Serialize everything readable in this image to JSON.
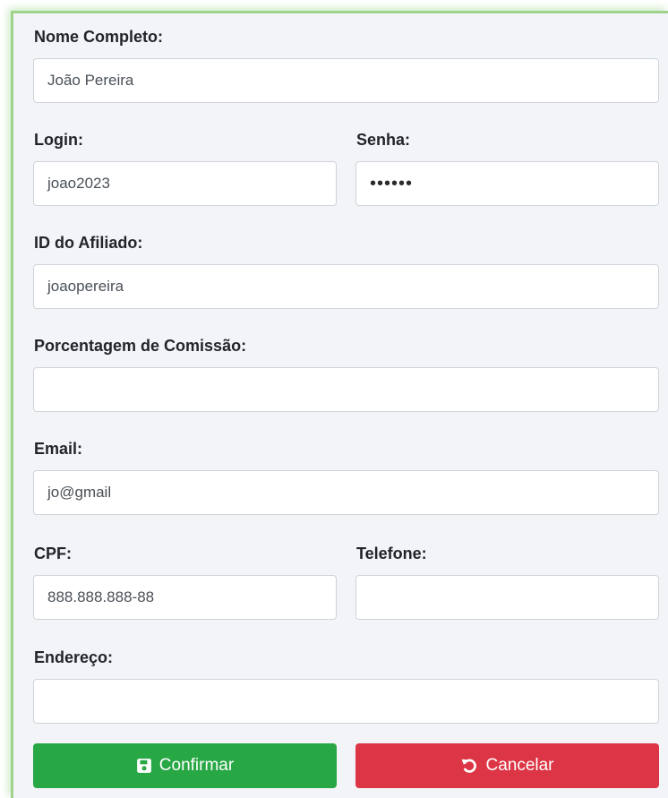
{
  "form": {
    "nome": {
      "label": "Nome Completo:",
      "value": "João Pereira"
    },
    "login": {
      "label": "Login:",
      "value": "joao2023"
    },
    "senha": {
      "label": "Senha:",
      "value": "••••••"
    },
    "afiliado": {
      "label": "ID do Afiliado:",
      "value": "joaopereira"
    },
    "comissao": {
      "label": "Porcentagem de Comissão:",
      "value": ""
    },
    "email": {
      "label": "Email:",
      "value": "jo@gmail"
    },
    "cpf": {
      "label": "CPF:",
      "value": "888.888.888-88"
    },
    "telefone": {
      "label": "Telefone:",
      "value": ""
    },
    "endereco": {
      "label": "Endereço:",
      "value": ""
    }
  },
  "buttons": {
    "confirm_label": "Confirmar",
    "confirm_icon": "save-icon",
    "cancel_label": "Cancelar",
    "cancel_icon": "undo-icon"
  },
  "colors": {
    "confirm": "#28a745",
    "cancel": "#dc3545",
    "card_border": "#9fd38d"
  }
}
